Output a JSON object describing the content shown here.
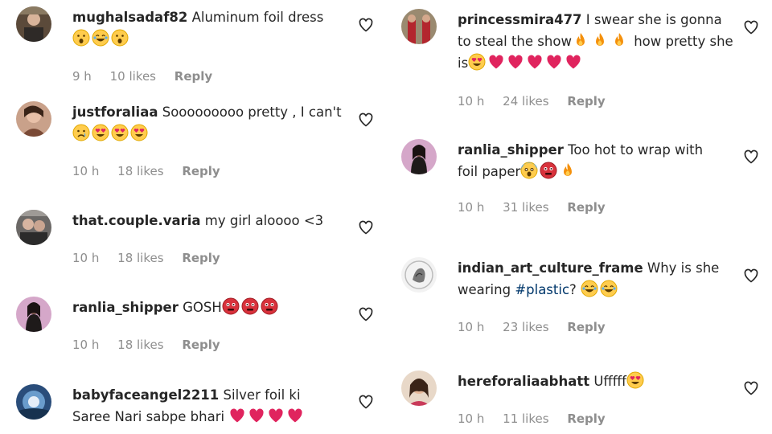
{
  "left_comments": [
    {
      "username": "mughalsadaf82",
      "text": "Aluminum foil dress",
      "emojis": [
        "shocked-face",
        "laughing-face",
        "shocked-face"
      ],
      "time": "9 h",
      "likes": "10 likes",
      "reply": "Reply"
    },
    {
      "username": "justforaliaa",
      "text": "Sooooooooo pretty , I can't",
      "emojis": [
        "crying-face",
        "heart-eyes",
        "heart-eyes",
        "heart-eyes"
      ],
      "time": "10 h",
      "likes": "18 likes",
      "reply": "Reply"
    },
    {
      "username": "that.couple.varia",
      "text": "my girl aloooo <3",
      "emojis": [],
      "time": "10 h",
      "likes": "18 likes",
      "reply": "Reply"
    },
    {
      "username": "ranlia_shipper",
      "text": "GOSH",
      "emojis": [
        "flushed-red",
        "flushed-red",
        "flushed-red"
      ],
      "time": "10 h",
      "likes": "18 likes",
      "reply": "Reply"
    },
    {
      "username": "babyfaceangel2211",
      "text": "Silver foil ki Saree Nari sabpe bhari",
      "emojis": [
        "red-heart",
        "red-heart",
        "red-heart",
        "red-heart"
      ],
      "time": "",
      "likes": "",
      "reply": ""
    }
  ],
  "right_comments": [
    {
      "username": "princessmira477",
      "text": "I swear she is gonna to steal the show",
      "emojis": [
        "fire",
        "fire",
        "fire"
      ],
      "text2": "how pretty she is",
      "emojis2": [
        "heart-eyes",
        "red-heart",
        "red-heart",
        "red-heart",
        "red-heart",
        "red-heart"
      ],
      "time": "10 h",
      "likes": "24 likes",
      "reply": "Reply"
    },
    {
      "username": "ranlia_shipper",
      "text": "Too hot to wrap with foil paper",
      "emojis": [
        "screaming-face",
        "flushed-red",
        "fire"
      ],
      "time": "10 h",
      "likes": "31 likes",
      "reply": "Reply"
    },
    {
      "username": "indian_art_culture_frame",
      "text": "Why is she wearing",
      "hashtag": "#plastic",
      "text2": "?",
      "emojis": [
        "laughing-face",
        "laughing-face"
      ],
      "time": "10 h",
      "likes": "23 likes",
      "reply": "Reply"
    },
    {
      "username": "hereforaliaabhatt",
      "text": "Ufffff",
      "emojis": [
        "heart-eyes"
      ],
      "time": "10 h",
      "likes": "11 likes",
      "reply": "Reply"
    }
  ],
  "colors": {
    "text": "#262626",
    "meta": "#8e8e8e",
    "hashtag": "#00376b",
    "heart_emoji": "#e0245e"
  }
}
